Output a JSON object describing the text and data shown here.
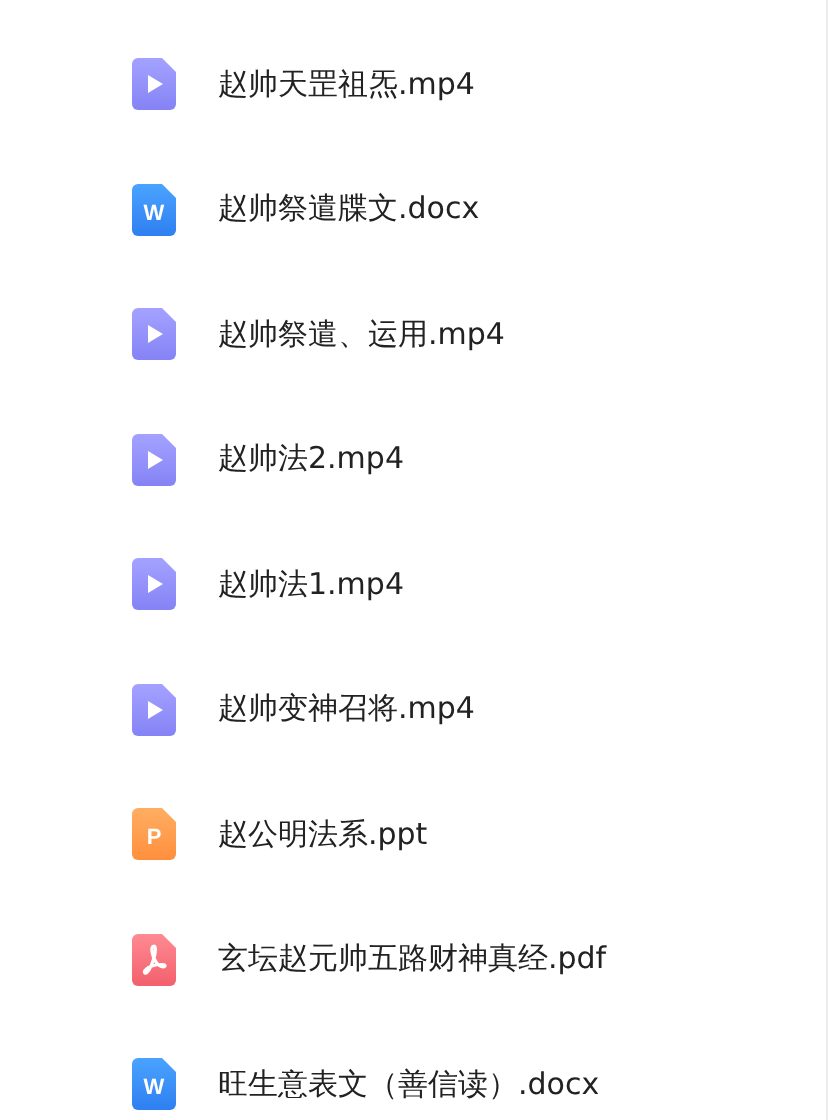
{
  "files": [
    {
      "name": "赵帅天罡祖炁.mp4",
      "kind": "video"
    },
    {
      "name": "赵帅祭遣牒文.docx",
      "kind": "word",
      "icon_text": "W"
    },
    {
      "name": "赵帅祭遣、运用.mp4",
      "kind": "video"
    },
    {
      "name": "赵帅法2.mp4",
      "kind": "video"
    },
    {
      "name": "赵帅法1.mp4",
      "kind": "video"
    },
    {
      "name": "赵帅变神召将.mp4",
      "kind": "video"
    },
    {
      "name": "赵公明法系.ppt",
      "kind": "ppt",
      "icon_text": "P"
    },
    {
      "name": "玄坛赵元帅五路财神真经.pdf",
      "kind": "pdf"
    },
    {
      "name": "旺生意表文（善信读）.docx",
      "kind": "word",
      "icon_text": "W"
    }
  ]
}
